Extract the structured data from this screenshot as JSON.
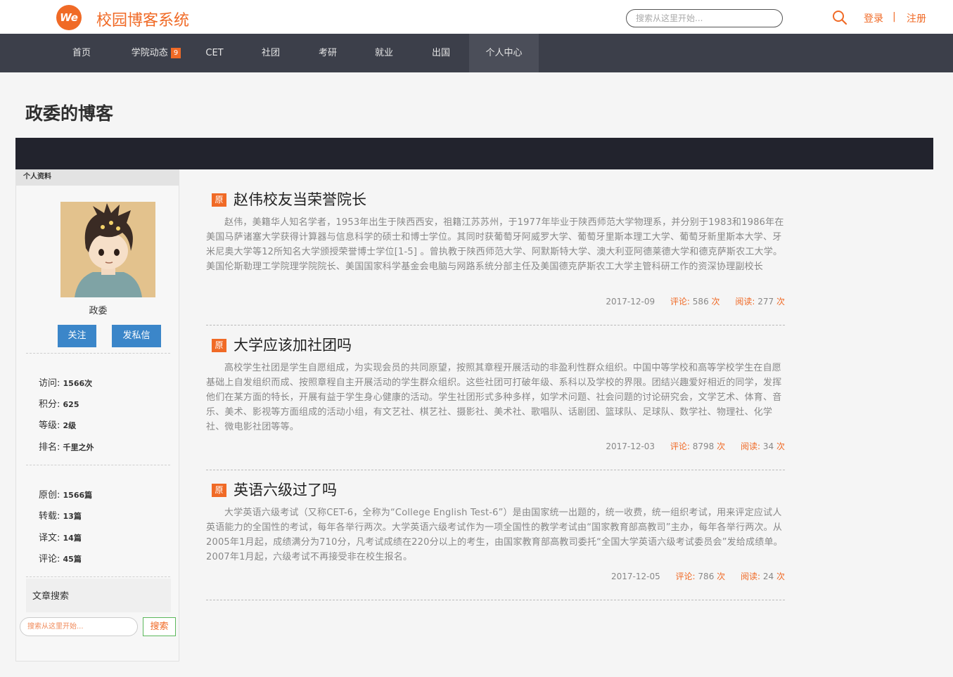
{
  "header": {
    "logo_text": "We",
    "site_title": "校园博客系统",
    "search_placeholder": "搜索从这里开始...",
    "login": "登录",
    "separator": "|",
    "register": "注册"
  },
  "nav": {
    "items": [
      {
        "label": "首页"
      },
      {
        "label": "学院动态",
        "badge": "9"
      },
      {
        "label": "CET"
      },
      {
        "label": "社团"
      },
      {
        "label": "考研"
      },
      {
        "label": "就业"
      },
      {
        "label": "出国"
      },
      {
        "label": "个人中心",
        "active": true
      }
    ]
  },
  "page_title": "政委的博客",
  "sidebar": {
    "header": "个人资料",
    "author": "政委",
    "follow_button": "关注",
    "message_button": "发私信",
    "stats": [
      {
        "label": "访问:",
        "value": "1566次"
      },
      {
        "label": "积分:",
        "value": "625"
      },
      {
        "label": "等级:",
        "value": "2级"
      },
      {
        "label": "排名:",
        "value": "千里之外"
      }
    ],
    "counts": [
      {
        "label": "原创:",
        "value": "1566篇"
      },
      {
        "label": "转载:",
        "value": "13篇"
      },
      {
        "label": "译文:",
        "value": "14篇"
      },
      {
        "label": "评论:",
        "value": "45篇"
      }
    ],
    "article_search_label": "文章搜索",
    "search_placeholder": "搜索从这里开始...",
    "search_button": "搜索"
  },
  "articles": [
    {
      "tag": "原",
      "title": "赵伟校友当荣誉院长",
      "body": "赵伟，美籍华人知名学者，1953年出生于陕西西安，祖籍江苏苏州，于1977年毕业于陕西师范大学物理系，并分别于1983和1986年在美国马萨诸塞大学获得计算器与信息科学的硕士和博士学位。其同时获葡萄牙阿威罗大学、葡萄牙里斯本理工大学、葡萄牙新里斯本大学、牙米尼奥大学等12所知名大学颁授荣誉博士学位[1-5] 。曾执教于陕西师范大学、阿默斯特大学、澳大利亚阿德莱德大学和德克萨斯农工大学。美国伦斯勒理工学院理学院院长、美国国家科学基金会电脑与网路系统分部主任及美国德克萨斯农工大学主管科研工作的资深协理副校长",
      "date": "2017-12-09",
      "comments_label": "评论:",
      "comments": "586",
      "reads_label": "阅读:",
      "reads": "277",
      "unit": "次"
    },
    {
      "tag": "原",
      "title": "大学应该加社团吗",
      "body": "高校学生社团是学生自愿组成，为实现会员的共同原望，按照其章程开展活动的非盈利性群众组织。中国中等学校和高等学校学生在自愿基础上自发组织而成、按照章程自主开展活动的学生群众组织。这些社团可打破年级、系科以及学校的界限。团结兴趣爱好相近的同学，发挥他们在某方面的特长，开展有益于学生身心健康的活动。学生社团形式多种多样，如学术问题、社会问题的讨论研究会，文学艺术、体育、音乐、美术、影视等方面组成的活动小组，有文艺社、棋艺社、摄影社、美术社、歌唱队、话剧团、篮球队、足球队、数学社、物理社、化学社、微电影社团等等。",
      "date": "2017-12-03",
      "comments_label": "评论:",
      "comments": "8798",
      "reads_label": "阅读:",
      "reads": "34",
      "unit": "次"
    },
    {
      "tag": "原",
      "title": "英语六级过了吗",
      "body": "大学英语六级考试（又称CET-6，全称为“College English Test-6”）是由国家统一出题的，统一收费，统一组织考试，用来评定应试人英语能力的全国性的考试，每年各举行两次。大学英语六级考试作为一项全国性的教学考试由“国家教育部高教司”主办，每年各举行两次。从2005年1月起，成绩满分为710分，凡考试成绩在220分以上的考生，由国家教育部高教司委托“全国大学英语六级考试委员会”发给成绩单。2007年1月起，六级考试不再接受非在校生报名。",
      "date": "2017-12-05",
      "comments_label": "评论:",
      "comments": "786",
      "reads_label": "阅读:",
      "reads": "24",
      "unit": "次"
    }
  ],
  "colors": {
    "accent": "#f06a26",
    "nav_bg": "#3c3f4a",
    "banner_bg": "#22232d",
    "button_blue": "#3b86c9"
  }
}
